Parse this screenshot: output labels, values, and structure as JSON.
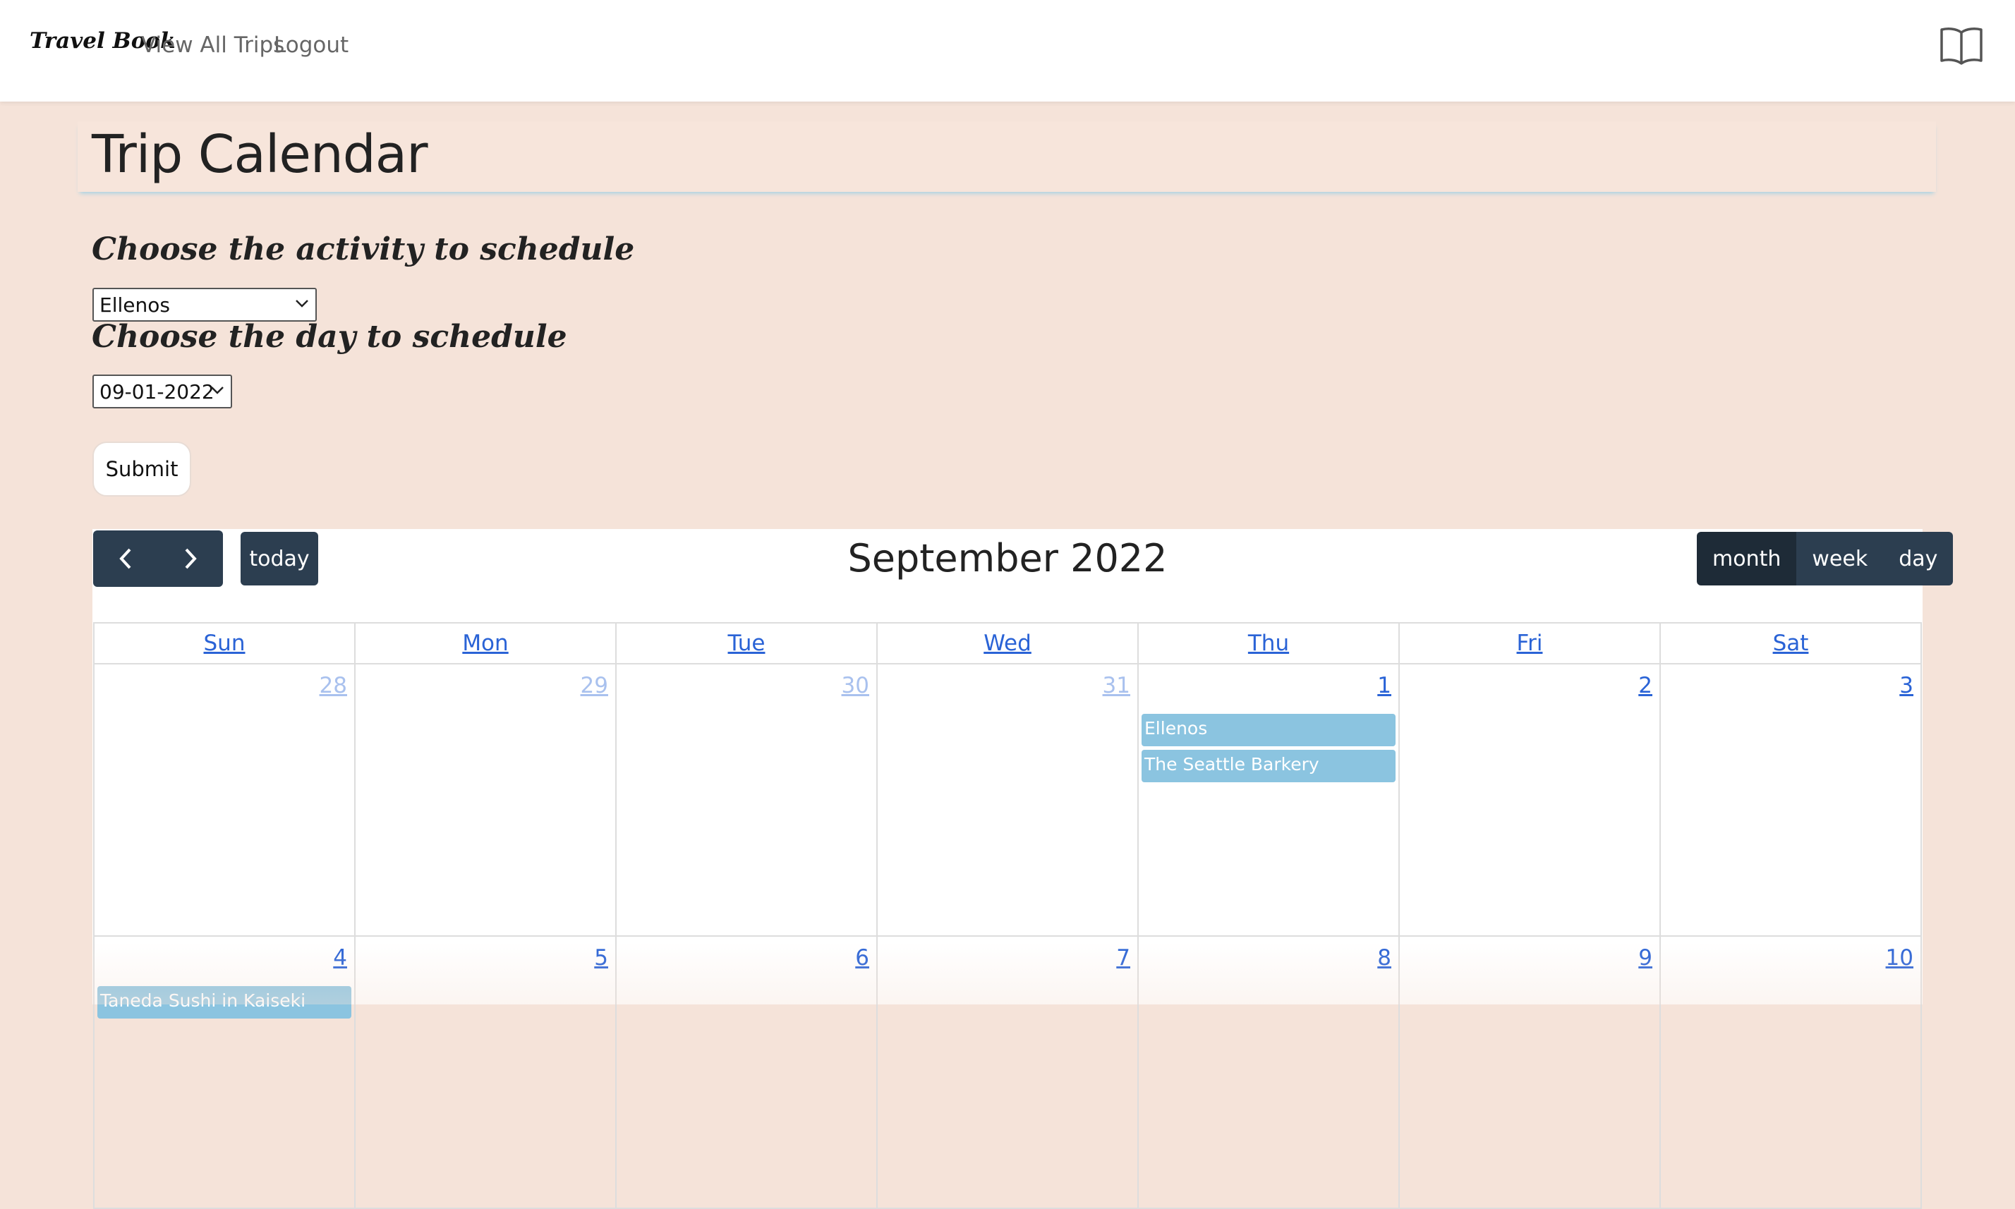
{
  "nav": {
    "brand": "Travel Book",
    "links": [
      "View All Trips",
      "Logout"
    ],
    "book_icon": "book-open-icon"
  },
  "page": {
    "title": "Trip Calendar"
  },
  "form": {
    "activity_heading": "Choose the activity to schedule",
    "activity_value": "Ellenos",
    "day_heading": "Choose the day to schedule",
    "day_value": "09-01-2022",
    "submit_label": "Submit"
  },
  "calendar": {
    "title": "September 2022",
    "prev_icon": "chevron-left-icon",
    "next_icon": "chevron-right-icon",
    "today_label": "today",
    "views": [
      "month",
      "week",
      "day"
    ],
    "active_view": "month",
    "weekdays": [
      "Sun",
      "Mon",
      "Tue",
      "Wed",
      "Thu",
      "Fri",
      "Sat"
    ],
    "week1": [
      "28",
      "29",
      "30",
      "31",
      "1",
      "2",
      "3"
    ],
    "week2": [
      "4",
      "5",
      "6",
      "7",
      "8",
      "9",
      "10"
    ],
    "events_sep1": [
      "Ellenos",
      "The Seattle Barkery"
    ],
    "events_sep4": [
      "Taneda Sushi in Kaiseki"
    ],
    "event_color": "#8bc4e0",
    "button_color": "#2c3e50",
    "link_color": "#2a63d6"
  }
}
